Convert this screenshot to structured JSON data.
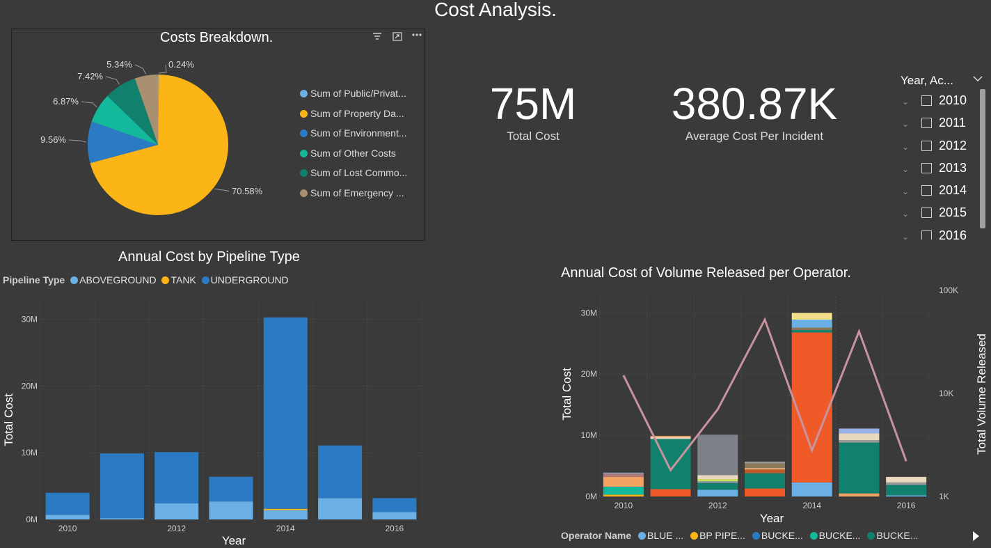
{
  "page": {
    "title": "Cost Analysis."
  },
  "costs_breakdown": {
    "title": "Costs Breakdown.",
    "icons": [
      "filter-icon",
      "focus-mode-icon",
      "more-options-icon"
    ],
    "legend": [
      {
        "label": "Sum of Public/Privat...",
        "color": "#6ab0e4"
      },
      {
        "label": "Sum of Property Da...",
        "color": "#fbb516"
      },
      {
        "label": "Sum of Environment...",
        "color": "#2b7ac4"
      },
      {
        "label": "Sum of Other Costs",
        "color": "#14b89a"
      },
      {
        "label": "Sum of Lost Commo...",
        "color": "#11806c"
      },
      {
        "label": "Sum of Emergency ...",
        "color": "#a89070"
      }
    ],
    "pie_labels": [
      "0.24%",
      "70.58%",
      "9.56%",
      "6.87%",
      "7.42%",
      "5.34%"
    ]
  },
  "kpis": {
    "total_cost": {
      "value": "75M",
      "label": "Total Cost"
    },
    "avg_cost": {
      "value": "380.87K",
      "label": "Average Cost Per Incident"
    }
  },
  "slicer": {
    "header": "Year, Ac...",
    "items": [
      "2010",
      "2011",
      "2012",
      "2013",
      "2014",
      "2015",
      "2016"
    ]
  },
  "pipeline_chart": {
    "title": "Annual Cost by Pipeline Type",
    "legend_title": "Pipeline Type",
    "legend": [
      {
        "label": "ABOVEGROUND",
        "color": "#6ab0e4"
      },
      {
        "label": "TANK",
        "color": "#fbb516"
      },
      {
        "label": "UNDERGROUND",
        "color": "#2b7ac4"
      }
    ],
    "xlabel": "Year",
    "ylabel": "Total Cost",
    "y_ticks": [
      "0M",
      "10M",
      "20M",
      "30M"
    ],
    "x_ticks": [
      "2010",
      "2012",
      "2014",
      "2016"
    ]
  },
  "operator_chart": {
    "title": "Annual Cost of Volume Released per Operator.",
    "xlabel": "Year",
    "ylabel_left": "Total Cost",
    "ylabel_right": "Total Volume Released",
    "y_ticks_left": [
      "0M",
      "10M",
      "20M",
      "30M"
    ],
    "y_ticks_right": [
      "1K",
      "10K",
      "100K"
    ],
    "x_ticks": [
      "2010",
      "2012",
      "2014",
      "2016"
    ],
    "legend_title": "Operator Name",
    "legend": [
      {
        "label": "BLUE ...",
        "color": "#6ab0e4"
      },
      {
        "label": "BP PIPE...",
        "color": "#fbb516"
      },
      {
        "label": "BUCKE...",
        "color": "#2b7ac4"
      },
      {
        "label": "BUCKE...",
        "color": "#14b89a"
      },
      {
        "label": "BUCKE...",
        "color": "#11806c"
      }
    ],
    "next_icon": "next-page-icon"
  },
  "chart_data": [
    {
      "type": "pie",
      "title": "Costs Breakdown.",
      "categories": [
        "Sum of Public/Privat...",
        "Sum of Property Da...",
        "Sum of Environment...",
        "Sum of Other Costs",
        "Sum of Lost Commo...",
        "Sum of Emergency ..."
      ],
      "values": [
        0.24,
        70.58,
        9.56,
        6.87,
        7.42,
        5.34
      ],
      "colors": [
        "#6ab0e4",
        "#fbb516",
        "#2b7ac4",
        "#14b89a",
        "#11806c",
        "#a89070"
      ]
    },
    {
      "type": "bar",
      "title": "Annual Cost by Pipeline Type",
      "categories": [
        "2010",
        "2011",
        "2012",
        "2013",
        "2014",
        "2015",
        "2016"
      ],
      "series": [
        {
          "name": "ABOVEGROUND",
          "color": "#6ab0e4",
          "values": [
            0.7,
            0.2,
            2.4,
            2.7,
            1.4,
            3.2,
            1.1
          ]
        },
        {
          "name": "TANK",
          "color": "#fbb516",
          "values": [
            0,
            0,
            0,
            0,
            0.2,
            0,
            0
          ]
        },
        {
          "name": "UNDERGROUND",
          "color": "#2b7ac4",
          "values": [
            3.3,
            9.7,
            7.7,
            3.7,
            28.7,
            7.9,
            2.1
          ]
        }
      ],
      "xlabel": "Year",
      "ylabel": "Total Cost",
      "ylim": [
        0,
        33
      ],
      "unit": "M"
    },
    {
      "type": "bar",
      "title": "Annual Cost of Volume Released per Operator.",
      "categories": [
        "2010",
        "2011",
        "2012",
        "2013",
        "2014",
        "2015",
        "2016"
      ],
      "stacks": [
        [
          {
            "v": 0.3,
            "c": "#fbb516"
          },
          {
            "v": 1.3,
            "c": "#14b89a"
          },
          {
            "v": 1.6,
            "c": "#f4a261"
          },
          {
            "v": 0.5,
            "c": "#b0787a"
          },
          {
            "v": 0.2,
            "c": "#8a9aa8"
          }
        ],
        [
          {
            "v": 1.2,
            "c": "#f05a28"
          },
          {
            "v": 8.2,
            "c": "#11806c"
          },
          {
            "v": 0.3,
            "c": "#e8d8c0"
          },
          {
            "v": 0.2,
            "c": "#f4a261"
          }
        ],
        [
          {
            "v": 1.1,
            "c": "#6ab0e4"
          },
          {
            "v": 1.1,
            "c": "#11806c"
          },
          {
            "v": 0.3,
            "c": "#8a9aa8"
          },
          {
            "v": 0.3,
            "c": "#c7e84a"
          },
          {
            "v": 0.7,
            "c": "#e8d8c0"
          },
          {
            "v": 6.6,
            "c": "#7e8288"
          }
        ],
        [
          {
            "v": 1.3,
            "c": "#f05a28"
          },
          {
            "v": 2.5,
            "c": "#11806c"
          },
          {
            "v": 0.6,
            "c": "#c05a28"
          },
          {
            "v": 0.3,
            "c": "#d8a878"
          },
          {
            "v": 0.7,
            "c": "#8a7a5a"
          },
          {
            "v": 0.3,
            "c": "#9a9a9a"
          }
        ],
        [
          {
            "v": 2.3,
            "c": "#6ab0e4"
          },
          {
            "v": 24.5,
            "c": "#f05a28"
          },
          {
            "v": 0.4,
            "c": "#11806c"
          },
          {
            "v": 0.4,
            "c": "#8a7a5a"
          },
          {
            "v": 1.3,
            "c": "#6ab0e4"
          },
          {
            "v": 1.1,
            "c": "#f4e08a"
          }
        ],
        [
          {
            "v": 0.5,
            "c": "#f4a261"
          },
          {
            "v": 8.3,
            "c": "#11806c"
          },
          {
            "v": 0.4,
            "c": "#9a9a9a"
          },
          {
            "v": 1.1,
            "c": "#e8d8c0"
          },
          {
            "v": 0.8,
            "c": "#9ab0e4"
          }
        ],
        [
          {
            "v": 0.2,
            "c": "#6ab0e4"
          },
          {
            "v": 1.7,
            "c": "#11806c"
          },
          {
            "v": 0.4,
            "c": "#9a9a9a"
          },
          {
            "v": 0.9,
            "c": "#e8d8c0"
          }
        ]
      ],
      "line": {
        "name": "Total Volume Released",
        "color": "#c9939e",
        "values": [
          15000,
          1800,
          7000,
          52000,
          2800,
          40000,
          2200
        ]
      },
      "xlabel": "Year",
      "ylabel": "Total Cost",
      "y2label": "Total Volume Released",
      "ylim": [
        0,
        33
      ],
      "y2lim": [
        1000,
        100000
      ],
      "y2_scale": "log"
    }
  ]
}
